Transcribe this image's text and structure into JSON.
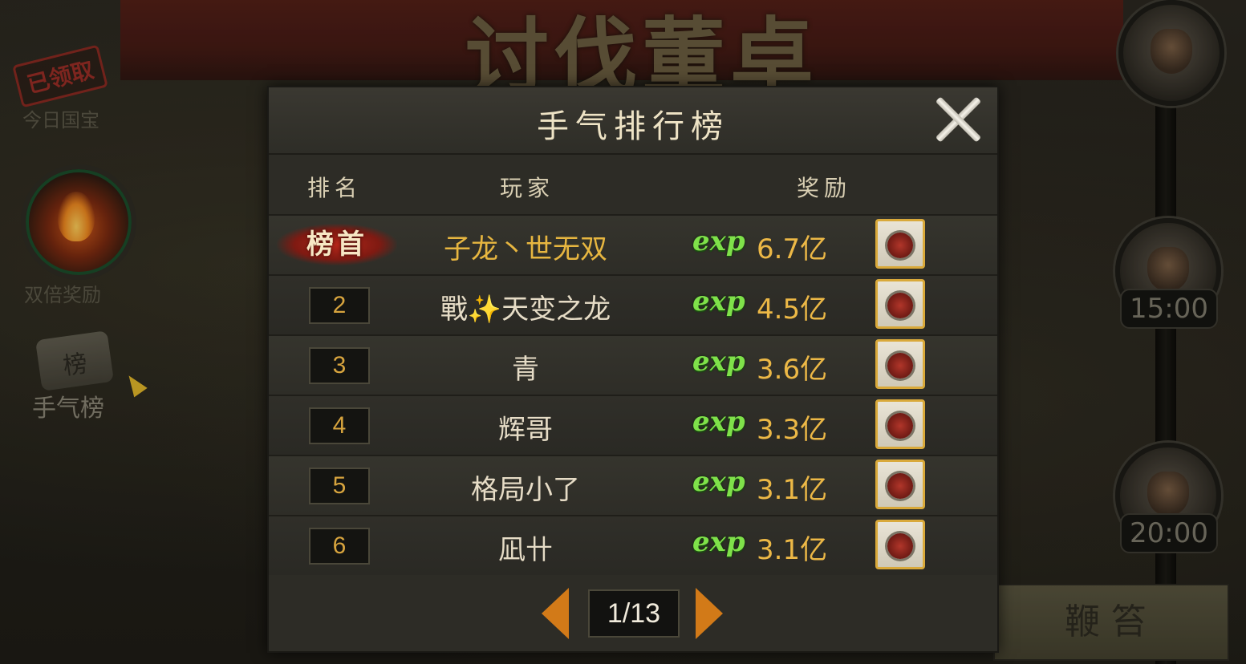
{
  "background": {
    "banner_title": "讨伐董卓",
    "left_panel": {
      "claimed_stamp": "已领取",
      "daily_treasure_label": "今日国宝",
      "double_reward_label": "双倍奖励",
      "luck_rank_label": "手气榜",
      "scroll_glyph": "榜"
    },
    "right_panel": {
      "timers": [
        "15:00",
        "20:00"
      ],
      "whip_button": "鞭笞"
    }
  },
  "modal": {
    "title": "手气排行榜",
    "columns": {
      "rank": "排名",
      "player": "玩家",
      "reward": "奖励"
    },
    "top_rank_label": "榜首",
    "exp_label": "exp",
    "rows": [
      {
        "rank": "1",
        "player": "子龙丶世无双",
        "amount": "6.7亿"
      },
      {
        "rank": "2",
        "player": "戰✨天变之龙",
        "amount": "4.5亿"
      },
      {
        "rank": "3",
        "player": "青",
        "amount": "3.6亿"
      },
      {
        "rank": "4",
        "player": "辉哥",
        "amount": "3.3亿"
      },
      {
        "rank": "5",
        "player": "格局小了",
        "amount": "3.1亿"
      },
      {
        "rank": "6",
        "player": "凪卄",
        "amount": "3.1亿"
      }
    ],
    "pagination": {
      "page": "1/13"
    }
  },
  "colors": {
    "gold_text": "#ecb846",
    "exp_green": "#7fe14a",
    "rank_first_red": "#b4261a",
    "arrow_orange": "#d27a18"
  }
}
